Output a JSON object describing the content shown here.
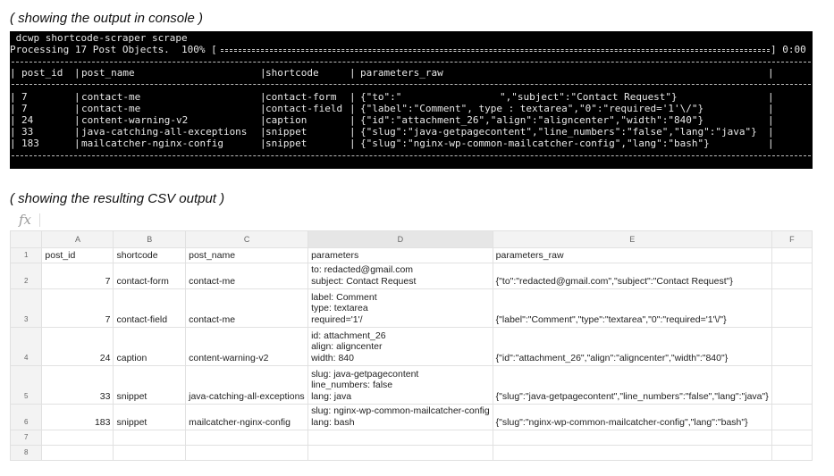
{
  "captions": {
    "console": "( showing the output in console )",
    "csv": "( showing the resulting CSV output )"
  },
  "console": {
    "command": " dcwp shortcode-scraper scrape",
    "progress": {
      "label": "Processing 17 Post Objects.  100% [",
      "end": "] 0:00",
      "fraction": 1.0
    },
    "headers": [
      "post_id",
      "post_name",
      "shortcode",
      "parameters_raw"
    ],
    "rows": [
      [
        "7",
        "contact-me",
        "contact-form",
        "{\"to\":\"         ",
        "\",\"subject\":\"Contact Request\"}"
      ],
      [
        "7",
        "contact-me",
        "contact-field",
        "{\"label\":\"Comment\", type : textarea\",\"0\":\"required='1'\\/\"}",
        ""
      ],
      [
        "24",
        "content-warning-v2",
        "caption",
        "{\"id\":\"attachment_26\",\"align\":\"aligncenter\",\"width\":\"840\"}",
        ""
      ],
      [
        "33",
        "java-catching-all-exceptions",
        "snippet",
        "{\"slug\":\"java-getpagecontent\",\"line_numbers\":\"false\",\"lang\":\"java\"}",
        ""
      ],
      [
        "183",
        "mailcatcher-nginx-config",
        "snippet",
        "{\"slug\":\"nginx-wp-common-mailcatcher-config\",\"lang\":\"bash\"}",
        ""
      ]
    ]
  },
  "sheet": {
    "fx_icon": "fx",
    "formula": "",
    "columns": [
      "A",
      "B",
      "C",
      "D",
      "E",
      "F"
    ],
    "row_numbers": [
      "1",
      "2",
      "3",
      "4",
      "5",
      "6",
      "7",
      "8"
    ],
    "selected_column": "D",
    "rows": [
      {
        "A": "post_id",
        "B": "shortcode",
        "C": "post_name",
        "D": [
          "parameters"
        ],
        "E": "parameters_raw"
      },
      {
        "A": "7",
        "B": "contact-form",
        "C": "contact-me",
        "D": [
          "to: redacted@gmail.com",
          "subject: Contact Request"
        ],
        "E": "{\"to\":\"redacted@gmail.com\",\"subject\":\"Contact Request\"}"
      },
      {
        "A": "7",
        "B": "contact-field",
        "C": "contact-me",
        "D": [
          "label: Comment",
          "type: textarea",
          "required='1'/"
        ],
        "E": "{\"label\":\"Comment\",\"type\":\"textarea\",\"0\":\"required='1'\\/\"}"
      },
      {
        "A": "24",
        "B": "caption",
        "C": "content-warning-v2",
        "D": [
          "id: attachment_26",
          "align: aligncenter",
          "width: 840"
        ],
        "E": "{\"id\":\"attachment_26\",\"align\":\"aligncenter\",\"width\":\"840\"}"
      },
      {
        "A": "33",
        "B": "snippet",
        "C": "java-catching-all-exceptions",
        "D": [
          "slug: java-getpagecontent",
          "line_numbers: false",
          "lang: java"
        ],
        "E": "{\"slug\":\"java-getpagecontent\",\"line_numbers\":\"false\",\"lang\":\"java\"}"
      },
      {
        "A": "183",
        "B": "snippet",
        "C": "mailcatcher-nginx-config",
        "D": [
          "slug: nginx-wp-common-mailcatcher-config",
          "lang: bash"
        ],
        "E": "{\"slug\":\"nginx-wp-common-mailcatcher-config\",\"lang\":\"bash\"}"
      },
      {
        "A": "",
        "B": "",
        "C": "",
        "D": [
          ""
        ],
        "E": ""
      },
      {
        "A": "",
        "B": "",
        "C": "",
        "D": [
          ""
        ],
        "E": ""
      }
    ]
  }
}
